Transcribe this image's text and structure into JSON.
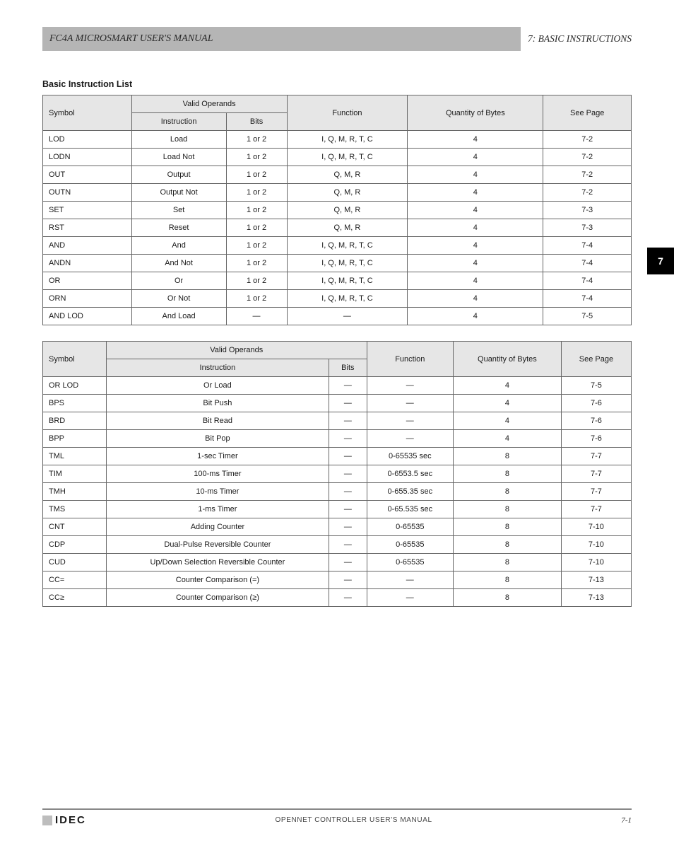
{
  "header": {
    "section_title": "FC4A MICROSMART USER'S MANUAL",
    "chapter": "7: BASIC INSTRUCTIONS"
  },
  "thumb_tab": "7",
  "section_heading": "Basic Instruction List",
  "tables": [
    {
      "lead": "",
      "columns": {
        "symbol": "Symbol",
        "valid_operands": "Valid Operands",
        "instr": "Instruction",
        "bits": "Bits",
        "function": "Function",
        "qty": "Quantity of Bytes",
        "see": "See Page"
      },
      "rows": [
        {
          "sym": "LOD",
          "instr": "Load",
          "bits": "1 or 2",
          "func": "I, Q, M, R, T, C",
          "qty": "4",
          "see": "7-2"
        },
        {
          "sym": "LODN",
          "instr": "Load Not",
          "bits": "1 or 2",
          "func": "I, Q, M, R, T, C",
          "qty": "4",
          "see": "7-2"
        },
        {
          "sym": "OUT",
          "instr": "Output",
          "bits": "1 or 2",
          "func": "Q, M, R",
          "qty": "4",
          "see": "7-2"
        },
        {
          "sym": "OUTN",
          "instr": "Output Not",
          "bits": "1 or 2",
          "func": "Q, M, R",
          "qty": "4",
          "see": "7-2"
        },
        {
          "sym": "SET",
          "instr": "Set",
          "bits": "1 or 2",
          "func": "Q, M, R",
          "qty": "4",
          "see": "7-3"
        },
        {
          "sym": "RST",
          "instr": "Reset",
          "bits": "1 or 2",
          "func": "Q, M, R",
          "qty": "4",
          "see": "7-3"
        },
        {
          "sym": "AND",
          "instr": "And",
          "bits": "1 or 2",
          "func": "I, Q, M, R, T, C",
          "qty": "4",
          "see": "7-4"
        },
        {
          "sym": "ANDN",
          "instr": "And Not",
          "bits": "1 or 2",
          "func": "I, Q, M, R, T, C",
          "qty": "4",
          "see": "7-4"
        },
        {
          "sym": "OR",
          "instr": "Or",
          "bits": "1 or 2",
          "func": "I, Q, M, R, T, C",
          "qty": "4",
          "see": "7-4"
        },
        {
          "sym": "ORN",
          "instr": "Or Not",
          "bits": "1 or 2",
          "func": "I, Q, M, R, T, C",
          "qty": "4",
          "see": "7-4"
        },
        {
          "sym": "AND LOD",
          "instr": "And Load",
          "bits": "—",
          "func": "—",
          "qty": "4",
          "see": "7-5"
        }
      ]
    },
    {
      "lead": "",
      "columns": {
        "symbol": "Symbol",
        "valid_operands": "Valid Operands",
        "instr": "Instruction",
        "bits": "Bits",
        "function": "Function",
        "qty": "Quantity of Bytes",
        "see": "See Page"
      },
      "rows": [
        {
          "sym": "OR LOD",
          "instr": "Or Load",
          "bits": "—",
          "func": "—",
          "qty": "4",
          "see": "7-5"
        },
        {
          "sym": "BPS",
          "instr": "Bit Push",
          "bits": "—",
          "func": "—",
          "qty": "4",
          "see": "7-6"
        },
        {
          "sym": "BRD",
          "instr": "Bit Read",
          "bits": "—",
          "func": "—",
          "qty": "4",
          "see": "7-6"
        },
        {
          "sym": "BPP",
          "instr": "Bit Pop",
          "bits": "—",
          "func": "—",
          "qty": "4",
          "see": "7-6"
        },
        {
          "sym": "TML",
          "instr": "1-sec Timer",
          "bits": "—",
          "func": "0-65535 sec",
          "qty": "8",
          "see": "7-7"
        },
        {
          "sym": "TIM",
          "instr": "100-ms Timer",
          "bits": "—",
          "func": "0-6553.5 sec",
          "qty": "8",
          "see": "7-7"
        },
        {
          "sym": "TMH",
          "instr": "10-ms Timer",
          "bits": "—",
          "func": "0-655.35 sec",
          "qty": "8",
          "see": "7-7"
        },
        {
          "sym": "TMS",
          "instr": "1-ms Timer",
          "bits": "—",
          "func": "0-65.535 sec",
          "qty": "8",
          "see": "7-7"
        },
        {
          "sym": "CNT",
          "instr": "Adding Counter",
          "bits": "—",
          "func": "0-65535",
          "qty": "8",
          "see": "7-10"
        },
        {
          "sym": "CDP",
          "instr": "Dual-Pulse Reversible Counter",
          "bits": "—",
          "func": "0-65535",
          "qty": "8",
          "see": "7-10"
        },
        {
          "sym": "CUD",
          "instr": "Up/Down Selection Reversible Counter",
          "bits": "—",
          "func": "0-65535",
          "qty": "8",
          "see": "7-10"
        },
        {
          "sym": "CC=",
          "instr": "Counter Comparison (=)",
          "bits": "—",
          "func": "—",
          "qty": "8",
          "see": "7-13"
        },
        {
          "sym": "CC≥",
          "instr": "Counter Comparison (≥)",
          "bits": "—",
          "func": "—",
          "qty": "8",
          "see": "7-13"
        }
      ]
    }
  ],
  "footer": {
    "brand": "IDEC",
    "manual": "OPENNET CONTROLLER USER'S MANUAL",
    "page": "7-1"
  }
}
